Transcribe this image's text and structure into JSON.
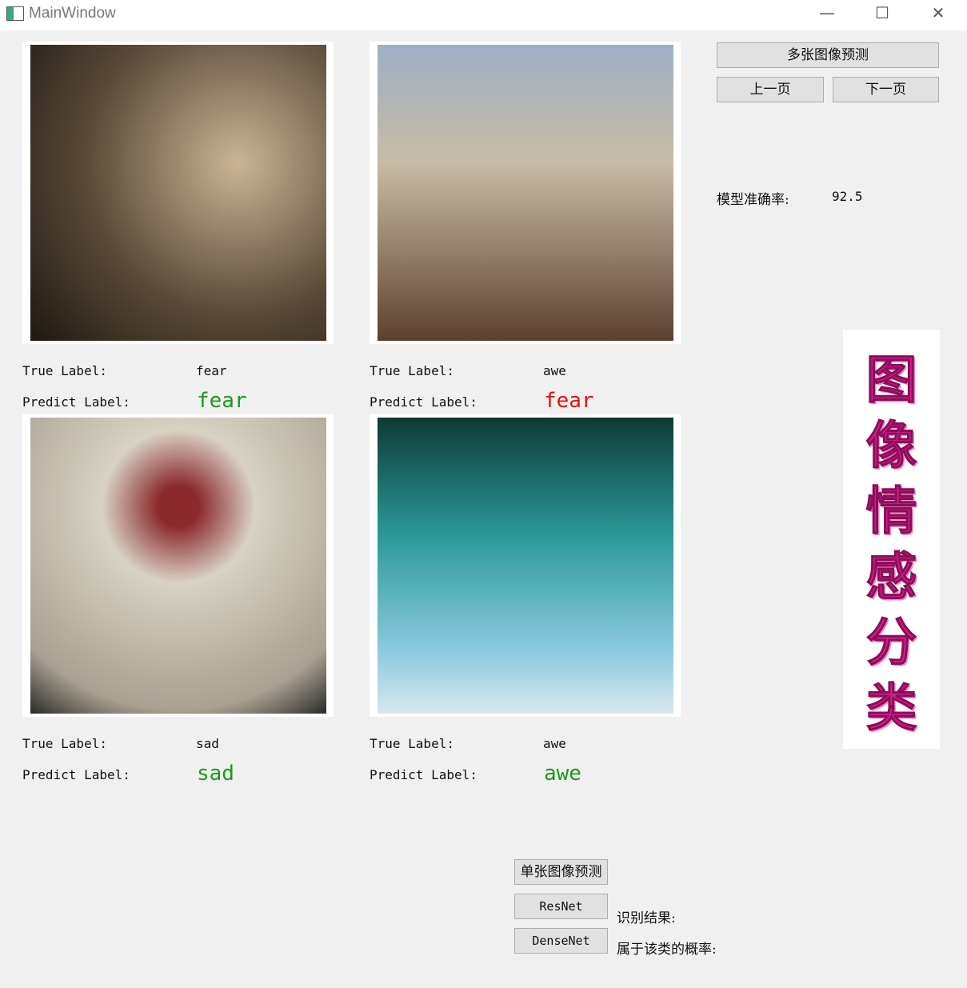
{
  "window": {
    "title": "MainWindow",
    "minimize": "—",
    "maximize": "☐",
    "close": "✕"
  },
  "controls": {
    "multi_predict": "多张图像预测",
    "prev_page": "上一页",
    "next_page": "下一页",
    "accuracy_label": "模型准确率:",
    "accuracy_value": "92.5"
  },
  "label_texts": {
    "true": "True Label:",
    "predict": "Predict Label:"
  },
  "images": [
    {
      "true_label": "fear",
      "predict_label": "fear",
      "predict_color": "#1a9a1a"
    },
    {
      "true_label": "awe",
      "predict_label": "fear",
      "predict_color": "#e01010"
    },
    {
      "true_label": "sad",
      "predict_label": "sad",
      "predict_color": "#1a9a1a"
    },
    {
      "true_label": "awe",
      "predict_label": "awe",
      "predict_color": "#1a9a1a"
    }
  ],
  "banner": {
    "chars": [
      "图",
      "像",
      "情",
      "感",
      "分",
      "类"
    ],
    "color": "#d21f8c"
  },
  "single": {
    "predict_button": "单张图像预测",
    "resnet_button": "ResNet",
    "densenet_button": "DenseNet",
    "result_label": "识别结果:",
    "prob_label": "属于该类的概率:"
  }
}
